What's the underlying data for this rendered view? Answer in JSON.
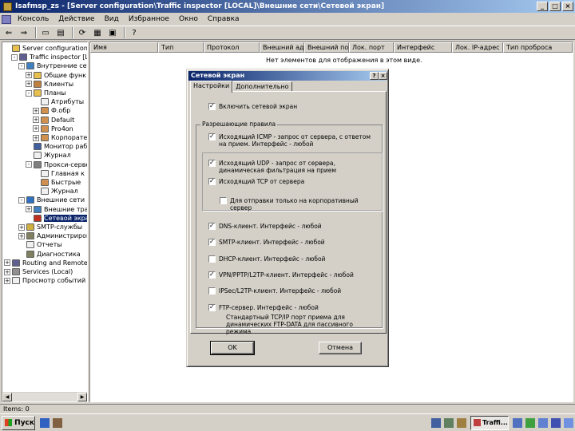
{
  "window": {
    "title": "Isafmsp_zs - [Server configuration\\Traffic inspector [LOCAL]\\Внешние сети\\Сетевой экран]"
  },
  "menu": [
    "Консоль",
    "Действие",
    "Вид",
    "Избранное",
    "Окно",
    "Справка"
  ],
  "tree": {
    "items": [
      {
        "label": "Server configuration",
        "indent": 0,
        "expander": "",
        "icon": "folder"
      },
      {
        "label": "Traffic inspector [LOC",
        "indent": 1,
        "expander": "-",
        "icon": "server"
      },
      {
        "label": "Внутренние сети",
        "indent": 2,
        "expander": "-",
        "icon": "network"
      },
      {
        "label": "Общие функ",
        "indent": 3,
        "expander": "+",
        "icon": "folder"
      },
      {
        "label": "Клиенты",
        "indent": 3,
        "expander": "+",
        "icon": "users"
      },
      {
        "label": "Планы",
        "indent": 3,
        "expander": "-",
        "icon": "folder"
      },
      {
        "label": "Атрибуты",
        "indent": 4,
        "expander": "",
        "icon": "doc"
      },
      {
        "label": "Ф.обр",
        "indent": 4,
        "expander": "+",
        "icon": "user"
      },
      {
        "label": "Default",
        "indent": 4,
        "expander": "+",
        "icon": "user"
      },
      {
        "label": "Pro4on",
        "indent": 4,
        "expander": "+",
        "icon": "user"
      },
      {
        "label": "Корпорате",
        "indent": 4,
        "expander": "+",
        "icon": "user"
      },
      {
        "label": "Монитор рабо",
        "indent": 3,
        "expander": "",
        "icon": "monitor"
      },
      {
        "label": "Журнал",
        "indent": 3,
        "expander": "",
        "icon": "doc"
      },
      {
        "label": "Прокси-серве",
        "indent": 3,
        "expander": "-",
        "icon": "proxy"
      },
      {
        "label": "Главная к",
        "indent": 4,
        "expander": "",
        "icon": "doc"
      },
      {
        "label": "Быстрые",
        "indent": 4,
        "expander": "",
        "icon": "user"
      },
      {
        "label": "Журнал",
        "indent": 4,
        "expander": "",
        "icon": "doc"
      },
      {
        "label": "Внешние сети",
        "indent": 2,
        "expander": "-",
        "icon": "globe"
      },
      {
        "label": "Внешние трафи",
        "indent": 3,
        "expander": "+",
        "icon": "network"
      },
      {
        "label": "Сетевой экра",
        "indent": 3,
        "expander": "",
        "icon": "firewall",
        "selected": true
      },
      {
        "label": "SMTP-службы",
        "indent": 2,
        "expander": "+",
        "icon": "mail"
      },
      {
        "label": "Администриров",
        "indent": 2,
        "expander": "+",
        "icon": "tools"
      },
      {
        "label": "Отчеты",
        "indent": 2,
        "expander": "",
        "icon": "doc"
      },
      {
        "label": "Диагностика",
        "indent": 2,
        "expander": "",
        "icon": "tools"
      },
      {
        "label": "Routing and Remote A",
        "indent": 0,
        "expander": "+",
        "icon": "server"
      },
      {
        "label": "Services (Local)",
        "indent": 0,
        "expander": "+",
        "icon": "gear"
      },
      {
        "label": "Просмотр событий (л",
        "indent": 0,
        "expander": "+",
        "icon": "doc"
      }
    ]
  },
  "list": {
    "columns": [
      "Имя",
      "Тип",
      "Протокол",
      "Внешний адрес",
      "Внешний порт",
      "Лок. порт",
      "Интерфейс",
      "Лок. IP-адрес",
      "Тип проброса"
    ],
    "empty_message": "Нет элементов для отображения в этом виде."
  },
  "statusbar": {
    "text": "Items: 0"
  },
  "taskbar": {
    "start_label": "Пуск",
    "task_label": "Traffi..."
  },
  "dialog": {
    "title": "Сетевой экран",
    "help_btn": "?",
    "close_btn": "×",
    "tabs": [
      "Настройки",
      "Дополнительно"
    ],
    "enable_firewall": {
      "label": "Включить сетевой экран",
      "checked": true
    },
    "group_title": "Разрешающие правила",
    "rules": [
      {
        "label": "Исходящий ICMP - запрос от сервера, с ответом на прием. Интерфейс - любой",
        "checked": true
      },
      {
        "label": "Исходящий UDP - запрос от сервера, динамическая фильтрация на прием",
        "checked": true
      },
      {
        "label": "Исходящий TCP от сервера",
        "checked": true
      },
      {
        "label": "Для отправки только на корпоративный сервер",
        "checked": false
      },
      {
        "label": "DNS-клиент. Интерфейс - любой",
        "checked": true
      },
      {
        "label": "SMTP-клиент. Интерфейс - любой",
        "checked": true
      },
      {
        "label": "DHCP-клиент. Интерфейс - любой",
        "checked": false
      },
      {
        "label": "VPN/PPTP/L2TP-клиент. Интерфейс - любой",
        "checked": true
      },
      {
        "label": "IPSec/L2TP-клиент. Интерфейс - любой",
        "checked": false
      },
      {
        "label": "FTP-сервер. Интерфейс - любой",
        "checked": true
      }
    ],
    "ftp_note": "Стандартный TCP/IP порт приема для динамических FTP-DATA для пассивного режима",
    "ok_label": "OK",
    "cancel_label": "Отмена"
  }
}
